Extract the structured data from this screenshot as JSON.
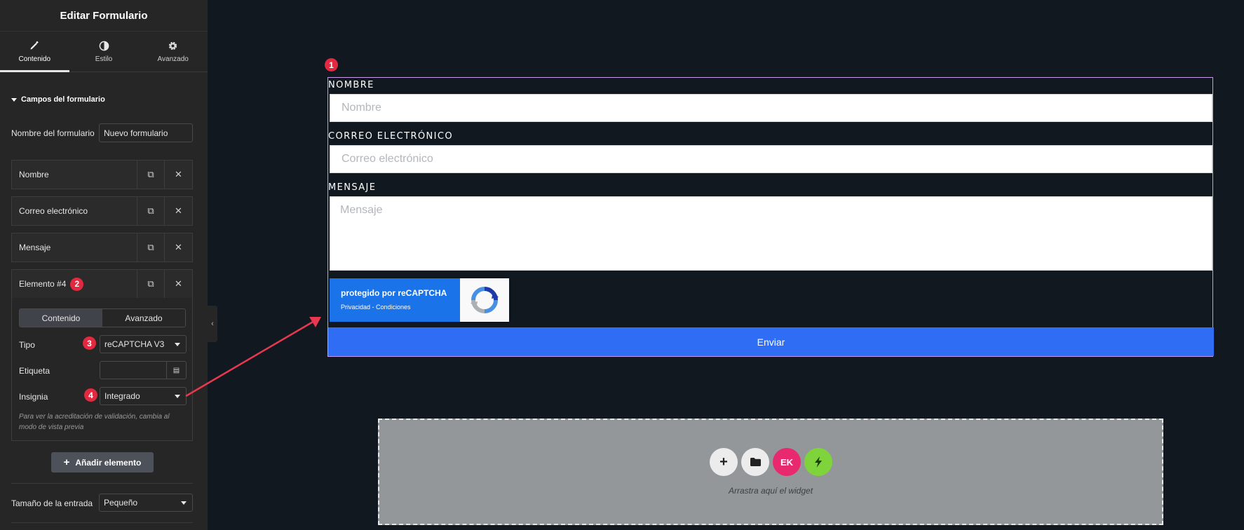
{
  "sidebar": {
    "title": "Editar Formulario",
    "tabs": [
      {
        "label": "Contenido",
        "icon": "pencil-icon"
      },
      {
        "label": "Estilo",
        "icon": "contrast-icon"
      },
      {
        "label": "Avanzado",
        "icon": "gear-icon"
      }
    ],
    "section_title": "Campos del formulario",
    "form_name_label": "Nombre del formulario",
    "form_name_value": "Nuevo formulario",
    "fields": [
      {
        "label": "Nombre"
      },
      {
        "label": "Correo electrónico"
      },
      {
        "label": "Mensaje"
      },
      {
        "label": "Elemento #4",
        "badge": "2"
      }
    ],
    "item_panel": {
      "tabs": [
        "Contenido",
        "Avanzado"
      ],
      "tipo_label": "Tipo",
      "tipo_badge": "3",
      "tipo_value": "reCAPTCHA V3",
      "etiqueta_label": "Etiqueta",
      "etiqueta_value": "",
      "insignia_label": "Insignia",
      "insignia_badge": "4",
      "insignia_value": "Integrado",
      "help_text": "Para ver la acreditación de validación, cambia al modo de vista previa"
    },
    "add_button": "Añadir elemento",
    "input_size_label": "Tamaño de la entrada",
    "input_size_value": "Pequeño"
  },
  "canvas": {
    "marker_badge": "1",
    "fields": [
      {
        "label": "NOMBRE",
        "placeholder": "Nombre"
      },
      {
        "label": "CORREO ELECTRÓNICO",
        "placeholder": "Correo electrónico"
      },
      {
        "label": "MENSAJE",
        "placeholder": "Mensaje"
      }
    ],
    "recaptcha": {
      "title": "protegido por reCAPTCHA",
      "links": "Privacidad - Condiciones"
    },
    "submit": "Enviar",
    "drop_zone_caption": "Arrastra aquí el widget"
  },
  "colors": {
    "badge": "#e2293f",
    "submit": "#2f6df5",
    "recaptcha": "#1a73e8",
    "form_border": "#c79be8",
    "elementskit": "#e8286f",
    "green_button": "#7ed43a"
  }
}
